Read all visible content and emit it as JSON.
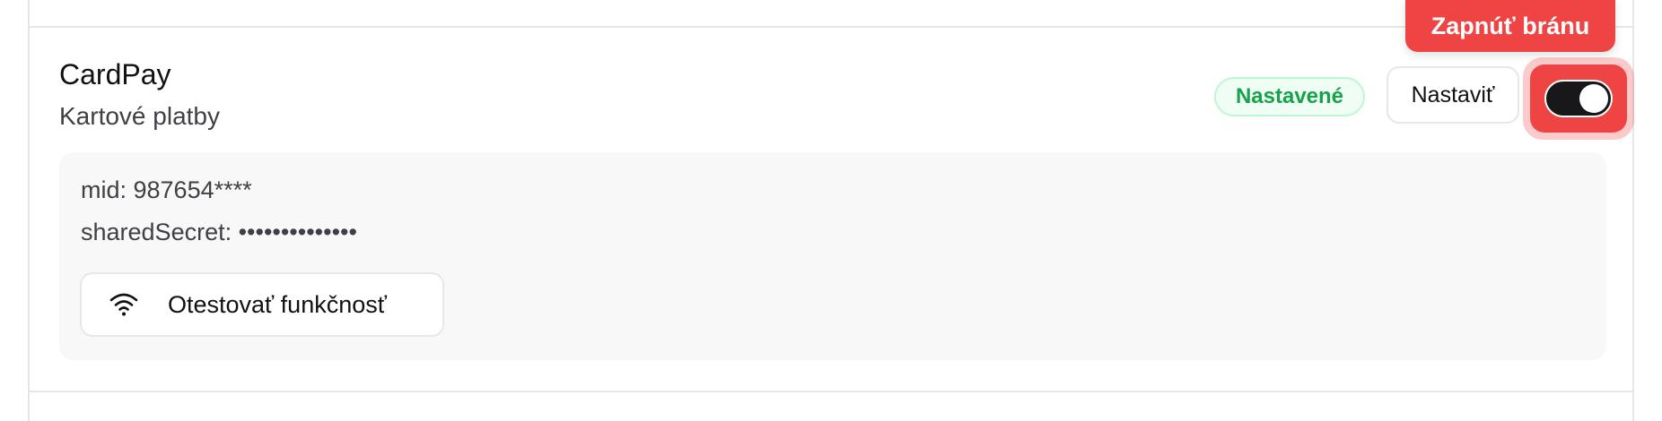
{
  "gateway": {
    "name": "CardPay",
    "description": "Kartové platby",
    "status_badge": "Nastavené",
    "setup_label": "Nastaviť",
    "enabled": true
  },
  "details": {
    "mid_line": "mid: 987654****",
    "secret_line": "sharedSecret: ••••••••••••••"
  },
  "test_button": {
    "icon": "wifi-icon",
    "label": "Otestovať funkčnosť"
  },
  "tooltip": {
    "text": "Zapnúť bránu"
  },
  "colors": {
    "accent_red": "#ef4444",
    "success_green": "#16a34a",
    "toggle_on": "#18181b"
  }
}
